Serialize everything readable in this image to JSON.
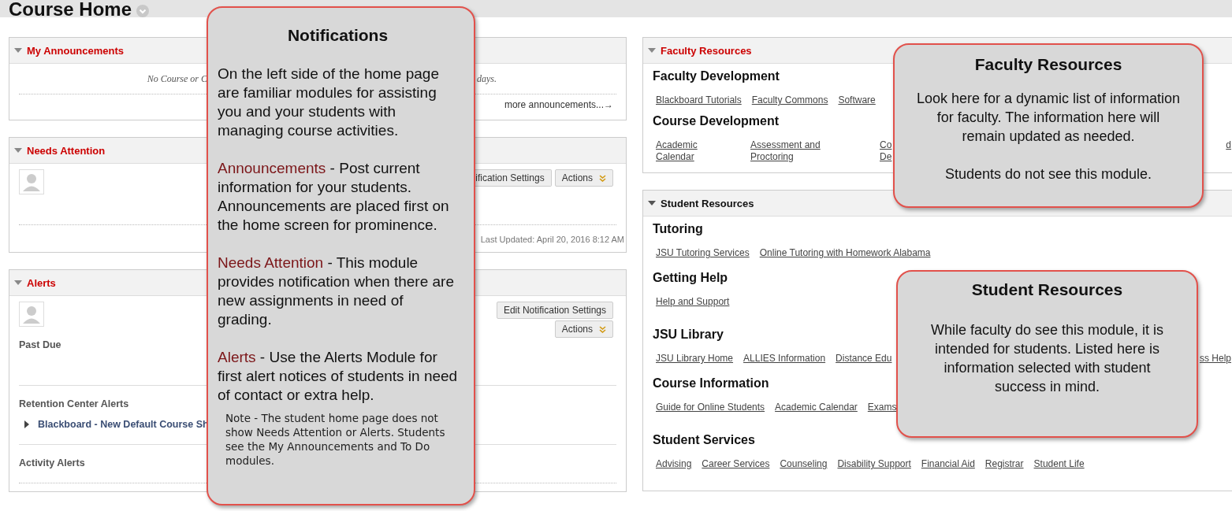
{
  "page": {
    "title": "Course Home"
  },
  "left_modules": [
    {
      "kind": "announcements",
      "title": "My Announcements",
      "expanded": true,
      "message_start": "No Course or C",
      "message_end": "days.",
      "more_link": "more announcements...→"
    },
    {
      "kind": "needs_attention",
      "title": "Needs Attention",
      "expanded": true,
      "buttons": [
        "ification Settings",
        "Actions"
      ],
      "last_updated": "Last Updated: April 20, 2016 8:12 AM"
    },
    {
      "kind": "alerts",
      "title": "Alerts",
      "expanded": true,
      "edit_button": "Edit Notification Settings",
      "actions_button": "Actions",
      "sections": [
        {
          "heading": "Past Due"
        },
        {
          "heading": "Retention Center Alerts",
          "items": [
            {
              "label": "Blackboard - New Default Course Sh",
              "expanded": false
            }
          ]
        },
        {
          "heading": "Activity Alerts"
        }
      ]
    }
  ],
  "right_modules": [
    {
      "kind": "faculty",
      "title": "Faculty Resources",
      "expanded": true,
      "groups": [
        {
          "heading": "Faculty Development",
          "kind": "inline",
          "links": [
            "Blackboard Tutorials",
            "Faculty Commons",
            "Software"
          ]
        },
        {
          "heading": "Course Development",
          "kind": "columns",
          "links": [
            "Academic Calendar",
            "Assessment and Proctoring",
            "Co De"
          ],
          "trailing_links": [
            "d"
          ]
        }
      ]
    },
    {
      "kind": "student",
      "title": "Student Resources",
      "expanded": true,
      "groups": [
        {
          "heading": "Tutoring",
          "kind": "inline",
          "links": [
            "JSU Tutoring Services",
            "Online Tutoring with Homework Alabama"
          ]
        },
        {
          "heading": "Getting Help",
          "kind": "inline",
          "links": [
            "Help and Support"
          ]
        },
        {
          "heading": "JSU Library",
          "kind": "inline",
          "links": [
            "JSU Library Home",
            "ALLIES Information",
            "Distance Edu"
          ],
          "trailing_links": [
            "ss Help"
          ]
        },
        {
          "heading": "Course Information",
          "kind": "inline",
          "links": [
            "Guide for Online Students",
            "Academic Calendar",
            "Exams"
          ]
        },
        {
          "heading": "Student Services",
          "kind": "inline",
          "links": [
            "Advising",
            "Career Services",
            "Counseling",
            "Disability Support",
            "Financial Aid",
            "Registrar",
            "Student Life"
          ]
        }
      ]
    }
  ],
  "callouts": [
    {
      "kind": "notifications",
      "title": "Notifications",
      "paragraphs": [
        {
          "text": "On the left side of the home page are familiar modules for assisting you and your students with managing course activities."
        },
        {
          "term": "Announcements",
          "text": " - Post current information for your students. Announcements are placed first on the home screen for prominence."
        },
        {
          "term": "Needs Attention",
          "text": " - This module provides notification when there are new assignments in need of grading."
        },
        {
          "term": "Alerts",
          "text": " - Use the Alerts Module for first alert notices of students in need of contact or extra help."
        }
      ],
      "note": "Note - The student home page does not show Needs Attention or Alerts. Students see the My Announcements and To Do modules."
    },
    {
      "kind": "faculty",
      "title": "Faculty Resources",
      "paragraphs": [
        {
          "text": "Look here for a dynamic list of information for faculty. The information here will remain updated as needed."
        },
        {
          "text": "Students do not see this module."
        }
      ]
    },
    {
      "kind": "student",
      "title": "Student Resources",
      "paragraphs": [
        {
          "text": "While faculty do see this module, it is intended for students. Listed here is information selected with student success in mind."
        }
      ]
    }
  ]
}
